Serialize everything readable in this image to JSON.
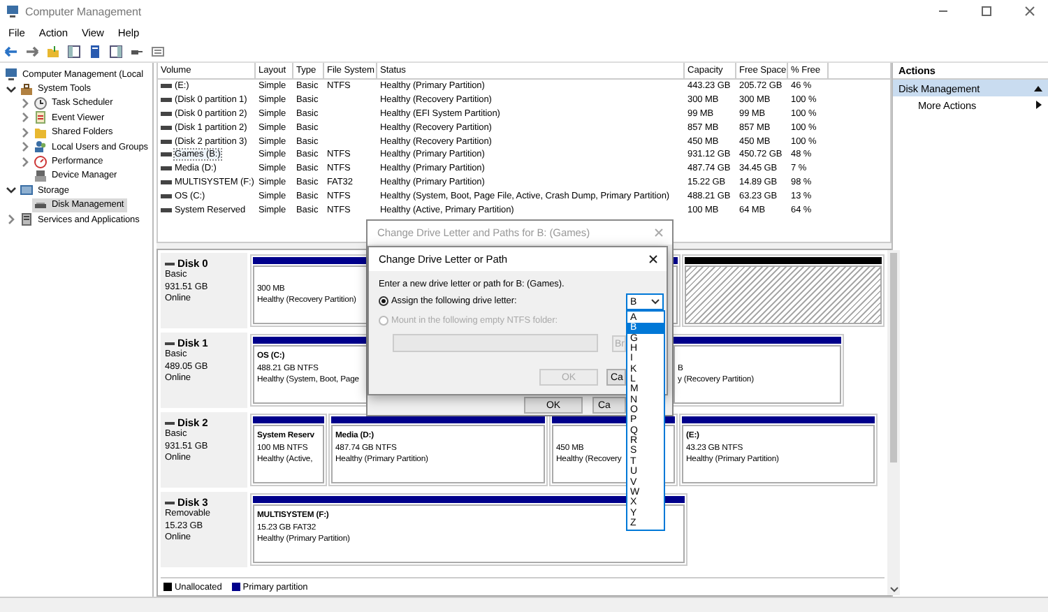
{
  "window": {
    "title": "Computer Management"
  },
  "menu": [
    "File",
    "Action",
    "View",
    "Help"
  ],
  "tree": [
    {
      "label": "Computer Management (Local",
      "selected": false,
      "children": [
        {
          "label": "System Tools",
          "expanded": true,
          "selected": false,
          "children": [
            {
              "label": "Task Scheduler",
              "expanded": false,
              "selected": false
            },
            {
              "label": "Event Viewer",
              "expanded": false,
              "selected": false
            },
            {
              "label": "Shared Folders",
              "expanded": false,
              "selected": false
            },
            {
              "label": "Local Users and Groups",
              "expanded": false,
              "selected": false
            },
            {
              "label": "Performance",
              "expanded": false,
              "selected": false
            },
            {
              "label": "Device Manager",
              "selected": false
            }
          ]
        },
        {
          "label": "Storage",
          "expanded": true,
          "selected": false,
          "children": [
            {
              "label": "Disk Management",
              "selected": true
            }
          ]
        },
        {
          "label": "Services and Applications",
          "expanded": false,
          "selected": false
        }
      ]
    }
  ],
  "volumes": {
    "columns": [
      "Volume",
      "Layout",
      "Type",
      "File System",
      "Status",
      "Capacity",
      "Free Space",
      "% Free"
    ],
    "rows": [
      {
        "volume": "(E:)",
        "layout": "Simple",
        "type": "Basic",
        "file_system": "NTFS",
        "status": "Healthy (Primary Partition)",
        "capacity": "443.23 GB",
        "free_space": "205.72 GB",
        "percent_free": "46 %",
        "selected": false
      },
      {
        "volume": "(Disk 0 partition 1)",
        "layout": "Simple",
        "type": "Basic",
        "status": "Healthy (Recovery Partition)",
        "capacity": "300 MB",
        "free_space": "300 MB",
        "percent_free": "100 %",
        "selected": false
      },
      {
        "volume": "(Disk 0 partition 2)",
        "layout": "Simple",
        "type": "Basic",
        "status": "Healthy (EFI System Partition)",
        "capacity": "99 MB",
        "free_space": "99 MB",
        "percent_free": "100 %",
        "selected": false
      },
      {
        "volume": "(Disk 1 partition 2)",
        "layout": "Simple",
        "type": "Basic",
        "status": "Healthy (Recovery Partition)",
        "capacity": "857 MB",
        "free_space": "857 MB",
        "percent_free": "100 %",
        "selected": false
      },
      {
        "volume": "(Disk 2 partition 3)",
        "layout": "Simple",
        "type": "Basic",
        "status": "Healthy (Recovery Partition)",
        "capacity": "450 MB",
        "free_space": "450 MB",
        "percent_free": "100 %",
        "selected": false
      },
      {
        "volume": "Games (B:)",
        "layout": "Simple",
        "type": "Basic",
        "file_system": "NTFS",
        "status": "Healthy (Primary Partition)",
        "capacity": "931.12 GB",
        "free_space": "450.72 GB",
        "percent_free": "48 %",
        "selected": true
      },
      {
        "volume": "Media (D:)",
        "layout": "Simple",
        "type": "Basic",
        "file_system": "NTFS",
        "status": "Healthy (Primary Partition)",
        "capacity": "487.74 GB",
        "free_space": "34.45 GB",
        "percent_free": "7 %",
        "selected": false
      },
      {
        "volume": "MULTISYSTEM (F:)",
        "layout": "Simple",
        "type": "Basic",
        "file_system": "FAT32",
        "status": "Healthy (Primary Partition)",
        "capacity": "15.22 GB",
        "free_space": "14.89 GB",
        "percent_free": "98 %",
        "selected": false
      },
      {
        "volume": "OS (C:)",
        "layout": "Simple",
        "type": "Basic",
        "file_system": "NTFS",
        "status": "Healthy (System, Boot, Page File, Active, Crash Dump, Primary Partition)",
        "capacity": "488.21 GB",
        "free_space": "63.23 GB",
        "percent_free": "13 %",
        "selected": false
      },
      {
        "volume": "System Reserved",
        "layout": "Simple",
        "type": "Basic",
        "file_system": "NTFS",
        "status": "Healthy (Active, Primary Partition)",
        "capacity": "100 MB",
        "free_space": "64 MB",
        "percent_free": "64 %",
        "selected": false
      }
    ]
  },
  "disks": [
    {
      "name": "Disk 0",
      "type": "Basic",
      "size": "931.51 GB",
      "state": "Online",
      "partitions": [
        {
          "kind": "primary",
          "size": "300 MB",
          "status": "Healthy (Recovery Partition)"
        },
        {
          "kind": "unallocated"
        }
      ]
    },
    {
      "name": "Disk 1",
      "type": "Basic",
      "size": "489.05 GB",
      "state": "Online",
      "partitions": [
        {
          "kind": "primary",
          "name": "OS (C:)",
          "size": "488.21 GB NTFS",
          "status": "Healthy (System, Boot, Page"
        },
        {
          "kind": "primary",
          "size": "B",
          "status": "y (Recovery Partition)"
        }
      ]
    },
    {
      "name": "Disk 2",
      "type": "Basic",
      "size": "931.51 GB",
      "state": "Online",
      "partitions": [
        {
          "kind": "primary",
          "name": "System Reserv",
          "size": "100 MB NTFS",
          "status": "Healthy (Active,"
        },
        {
          "kind": "primary",
          "name": "Media (D:)",
          "size": "487.74 GB NTFS",
          "status": "Healthy (Primary Partition)"
        },
        {
          "kind": "primary",
          "size": "450 MB",
          "status": "Healthy (Recovery"
        },
        {
          "kind": "primary",
          "name": "(E:)",
          "size": "43.23 GB NTFS",
          "status": "Healthy (Primary Partition)"
        }
      ]
    },
    {
      "name": "Disk 3",
      "type": "Removable",
      "size": "15.23 GB",
      "state": "Online",
      "partitions": [
        {
          "kind": "primary",
          "name": "MULTISYSTEM (F:)",
          "size": "15.23 GB FAT32",
          "status": "Healthy (Primary Partition)"
        }
      ]
    }
  ],
  "legend": [
    {
      "label": "Unallocated",
      "color": "#000000"
    },
    {
      "label": "Primary partition",
      "color": "#00008b"
    }
  ],
  "actions": {
    "title": "Actions",
    "items": [
      {
        "kind": "section",
        "label": "Disk Management"
      },
      {
        "kind": "link",
        "label": "More Actions"
      }
    ]
  },
  "back_dialog": {
    "title": "Change Drive Letter and Paths for B: (Games)",
    "buttons": [
      "OK",
      "Ca"
    ]
  },
  "front_dialog": {
    "title": "Change Drive Letter or Path",
    "prompt": "Enter a new drive letter or path for B: (Games).",
    "options": [
      {
        "label": "Assign the following drive letter:",
        "selected": true,
        "disabled": false
      },
      {
        "label": "Mount in the following empty NTFS folder:",
        "selected": false,
        "disabled": true
      }
    ],
    "drive_combo": {
      "value": "B"
    },
    "folder_field": {
      "disabled": true
    },
    "browse_button": {
      "label": "Br",
      "disabled": true
    },
    "buttons": [
      {
        "label": "OK",
        "disabled": true
      },
      {
        "label": "Ca",
        "disabled": false
      }
    ]
  },
  "drive_list": [
    {
      "label": "A",
      "selected": false
    },
    {
      "label": "B",
      "selected": true
    },
    {
      "label": "G",
      "selected": false
    },
    {
      "label": "H",
      "selected": false
    },
    {
      "label": "I",
      "selected": false
    },
    {
      "label": "K",
      "selected": false
    },
    {
      "label": "L",
      "selected": false
    },
    {
      "label": "M",
      "selected": false
    },
    {
      "label": "N",
      "selected": false
    },
    {
      "label": "O",
      "selected": false
    },
    {
      "label": "P",
      "selected": false
    },
    {
      "label": "Q",
      "selected": false
    },
    {
      "label": "R",
      "selected": false
    },
    {
      "label": "S",
      "selected": false
    },
    {
      "label": "T",
      "selected": false
    },
    {
      "label": "U",
      "selected": false
    },
    {
      "label": "V",
      "selected": false
    },
    {
      "label": "W",
      "selected": false
    },
    {
      "label": "X",
      "selected": false
    },
    {
      "label": "Y",
      "selected": false
    },
    {
      "label": "Z",
      "selected": false
    }
  ]
}
